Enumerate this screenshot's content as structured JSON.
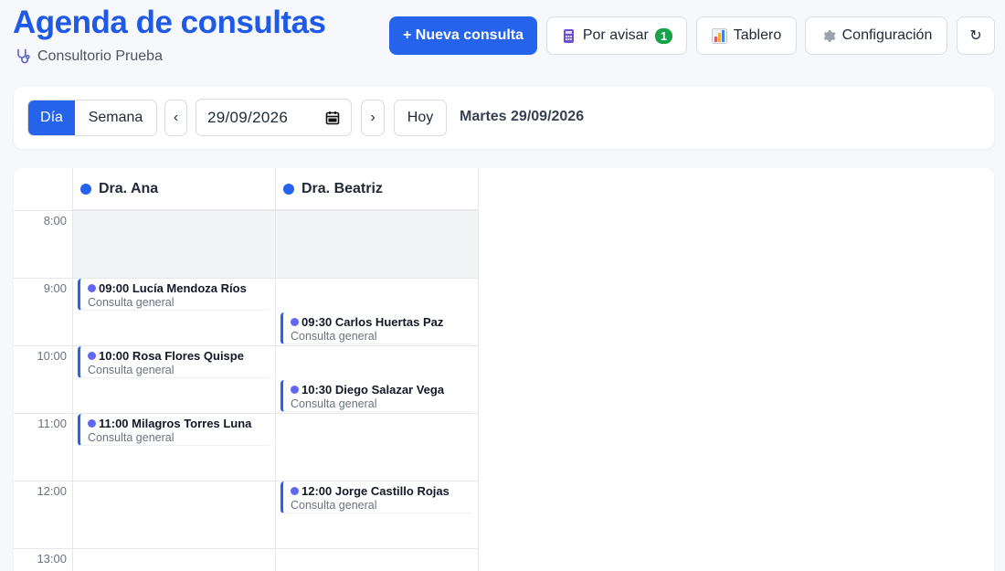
{
  "header": {
    "title": "Agenda de consultas",
    "clinic": "Consultorio Prueba",
    "new_button": "+ Nueva consulta",
    "notify_button": "Por avisar",
    "notify_count": "1",
    "board_button": "Tablero",
    "config_button": "Configuración",
    "refresh_button": "↻"
  },
  "toolbar": {
    "view_day": "Día",
    "view_week": "Semana",
    "prev": "‹",
    "date_value": "29/09/2026",
    "next": "›",
    "today": "Hoy",
    "date_label": "Martes 29/09/2026"
  },
  "calendar": {
    "doctors": [
      "Dra. Ana",
      "Dra. Beatriz"
    ],
    "hours": [
      "8:00",
      "9:00",
      "10:00",
      "11:00",
      "12:00",
      "13:00"
    ],
    "appointments": [
      {
        "doctor": 0,
        "time": "09:00",
        "title": "09:00 Lucía Mendoza Ríos",
        "type": "Consulta general"
      },
      {
        "doctor": 1,
        "time": "09:30",
        "title": "09:30 Carlos Huertas Paz",
        "type": "Consulta general"
      },
      {
        "doctor": 0,
        "time": "10:00",
        "title": "10:00 Rosa Flores Quispe",
        "type": "Consulta general"
      },
      {
        "doctor": 1,
        "time": "10:30",
        "title": "10:30 Diego Salazar Vega",
        "type": "Consulta general"
      },
      {
        "doctor": 0,
        "time": "11:00",
        "title": "11:00 Milagros Torres Luna",
        "type": "Consulta general"
      },
      {
        "doctor": 1,
        "time": "12:00",
        "title": "12:00 Jorge Castillo Rojas",
        "type": "Consulta general"
      }
    ]
  },
  "colors": {
    "accent": "#2563eb",
    "badge": "#16a34a",
    "appt_dot": "#6366f1"
  }
}
